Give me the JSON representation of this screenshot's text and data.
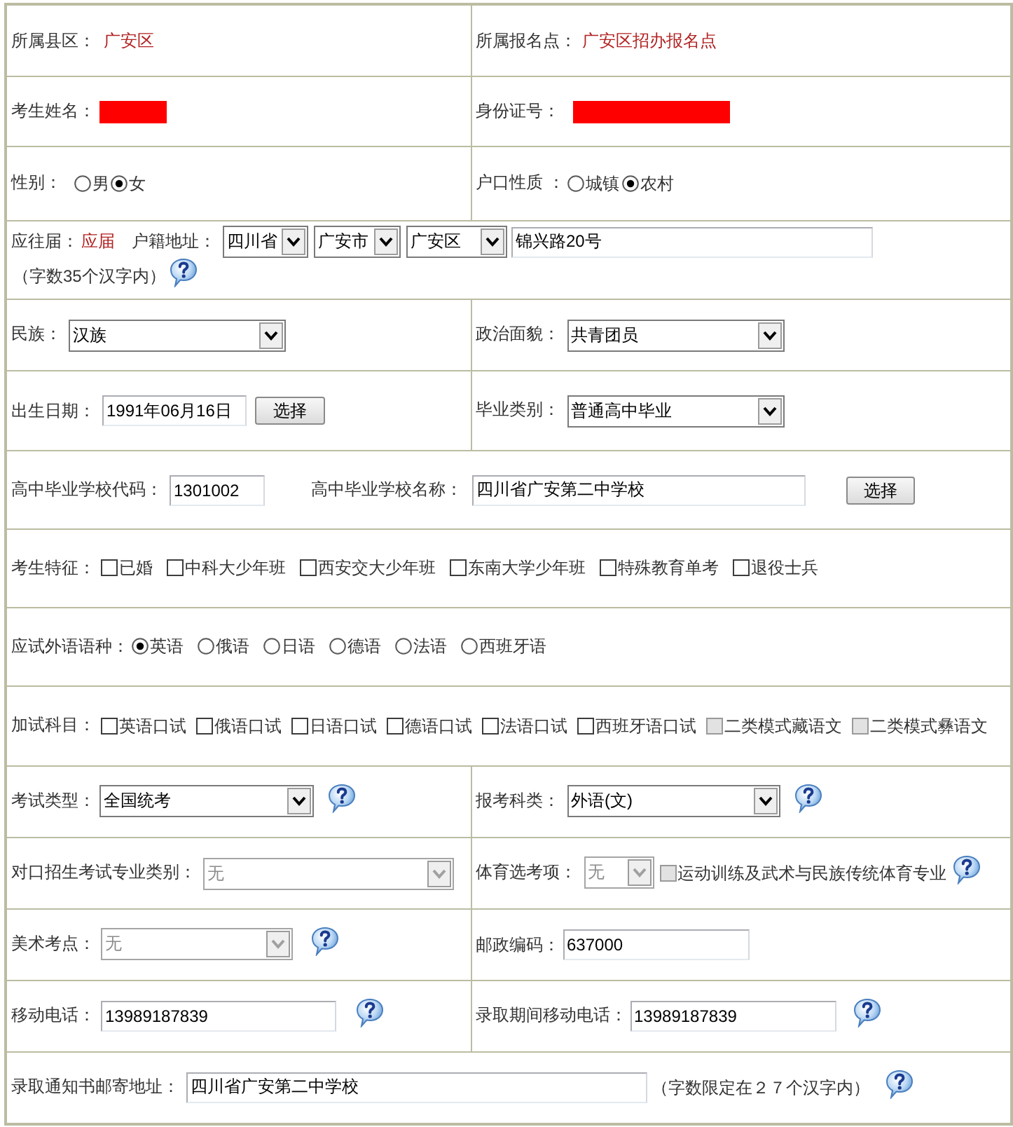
{
  "rows": [
    {
      "cells": [
        {
          "items": [
            {
              "kind": "label",
              "text": "所属县区："
            },
            {
              "kind": "value",
              "text": "广安区"
            }
          ]
        },
        {
          "items": [
            {
              "kind": "label",
              "text": "所属报名点："
            },
            {
              "kind": "value",
              "text": "广安区招办报名点"
            }
          ]
        }
      ]
    },
    {
      "cells": [
        {
          "items": [
            {
              "kind": "label",
              "text": "考生姓名："
            },
            {
              "kind": "redacted"
            }
          ]
        },
        {
          "items": [
            {
              "kind": "label",
              "text": "身份证号："
            },
            {
              "kind": "redacted"
            }
          ]
        }
      ]
    },
    {
      "cells": [
        {
          "items": [
            {
              "kind": "label",
              "text": "性别："
            },
            {
              "kind": "radio",
              "label": "男",
              "selected": false
            },
            {
              "kind": "radio",
              "label": "女",
              "selected": true
            }
          ]
        },
        {
          "items": [
            {
              "kind": "label",
              "text": "户口性质 ："
            },
            {
              "kind": "radio",
              "label": "城镇",
              "selected": false
            },
            {
              "kind": "radio",
              "label": "农村",
              "selected": true
            }
          ]
        }
      ]
    },
    {
      "cells": [
        {
          "items": [
            {
              "kind": "label",
              "text": "应往届："
            },
            {
              "kind": "value",
              "text": "应届"
            },
            {
              "kind": "label",
              "text": "户籍地址："
            },
            {
              "kind": "select",
              "value": "四川省",
              "disabled": false
            },
            {
              "kind": "select",
              "value": "广安市",
              "disabled": false
            },
            {
              "kind": "select",
              "value": "广安区",
              "disabled": false
            },
            {
              "kind": "input",
              "value": "锦兴路20号"
            },
            {
              "kind": "hint",
              "text": "（字数35个汉字内）"
            },
            {
              "kind": "help"
            }
          ]
        }
      ]
    },
    {
      "cells": [
        {
          "items": [
            {
              "kind": "label",
              "text": "民族："
            },
            {
              "kind": "select",
              "value": "汉族",
              "disabled": false
            }
          ]
        },
        {
          "items": [
            {
              "kind": "label",
              "text": "政治面貌："
            },
            {
              "kind": "select",
              "value": "共青团员",
              "disabled": false
            }
          ]
        }
      ]
    },
    {
      "cells": [
        {
          "items": [
            {
              "kind": "label",
              "text": "出生日期："
            },
            {
              "kind": "input",
              "value": "1991年06月16日"
            },
            {
              "kind": "button",
              "text": "选择"
            }
          ]
        },
        {
          "items": [
            {
              "kind": "label",
              "text": "毕业类别："
            },
            {
              "kind": "select",
              "value": "普通高中毕业",
              "disabled": false
            }
          ]
        }
      ]
    },
    {
      "cells": [
        {
          "items": [
            {
              "kind": "label",
              "text": "高中毕业学校代码："
            },
            {
              "kind": "input",
              "value": "1301002"
            },
            {
              "kind": "label",
              "text": "高中毕业学校名称："
            },
            {
              "kind": "input",
              "value": "四川省广安第二中学校"
            },
            {
              "kind": "button",
              "text": "选择"
            }
          ]
        }
      ]
    },
    {
      "cells": [
        {
          "items": [
            {
              "kind": "label",
              "text": "考生特征："
            },
            {
              "kind": "checkbox",
              "label": "已婚",
              "checked": false,
              "disabled": false
            },
            {
              "kind": "checkbox",
              "label": "中科大少年班",
              "checked": false,
              "disabled": false
            },
            {
              "kind": "checkbox",
              "label": "西安交大少年班",
              "checked": false,
              "disabled": false
            },
            {
              "kind": "checkbox",
              "label": "东南大学少年班",
              "checked": false,
              "disabled": false
            },
            {
              "kind": "checkbox",
              "label": "特殊教育单考",
              "checked": false,
              "disabled": false
            },
            {
              "kind": "checkbox",
              "label": "退役士兵",
              "checked": false,
              "disabled": false
            }
          ]
        }
      ]
    },
    {
      "cells": [
        {
          "items": [
            {
              "kind": "label",
              "text": "应试外语语种："
            },
            {
              "kind": "radio",
              "label": "英语",
              "selected": true
            },
            {
              "kind": "radio",
              "label": "俄语",
              "selected": false
            },
            {
              "kind": "radio",
              "label": "日语",
              "selected": false
            },
            {
              "kind": "radio",
              "label": "德语",
              "selected": false
            },
            {
              "kind": "radio",
              "label": "法语",
              "selected": false
            },
            {
              "kind": "radio",
              "label": "西班牙语",
              "selected": false
            }
          ]
        }
      ]
    },
    {
      "cells": [
        {
          "items": [
            {
              "kind": "label",
              "text": "加试科目："
            },
            {
              "kind": "checkbox",
              "label": "英语口试",
              "checked": false,
              "disabled": false
            },
            {
              "kind": "checkbox",
              "label": "俄语口试",
              "checked": false,
              "disabled": false
            },
            {
              "kind": "checkbox",
              "label": "日语口试",
              "checked": false,
              "disabled": false
            },
            {
              "kind": "checkbox",
              "label": "德语口试",
              "checked": false,
              "disabled": false
            },
            {
              "kind": "checkbox",
              "label": "法语口试",
              "checked": false,
              "disabled": false
            },
            {
              "kind": "checkbox",
              "label": "西班牙语口试",
              "checked": false,
              "disabled": false
            },
            {
              "kind": "checkbox",
              "label": "二类模式藏语文",
              "checked": false,
              "disabled": true
            },
            {
              "kind": "checkbox",
              "label": "二类模式彝语文",
              "checked": false,
              "disabled": true
            }
          ]
        }
      ]
    },
    {
      "cells": [
        {
          "items": [
            {
              "kind": "label",
              "text": "考试类型："
            },
            {
              "kind": "select",
              "value": "全国统考",
              "disabled": false
            },
            {
              "kind": "help"
            }
          ]
        },
        {
          "items": [
            {
              "kind": "label",
              "text": "报考科类："
            },
            {
              "kind": "select",
              "value": "外语(文)",
              "disabled": false
            },
            {
              "kind": "help"
            }
          ]
        }
      ]
    },
    {
      "cells": [
        {
          "items": [
            {
              "kind": "label",
              "text": "对口招生考试专业类别："
            },
            {
              "kind": "select",
              "value": "无",
              "disabled": true
            }
          ]
        },
        {
          "items": [
            {
              "kind": "label",
              "text": "体育选考项："
            },
            {
              "kind": "select",
              "value": "无",
              "disabled": true
            },
            {
              "kind": "checkbox",
              "label": "运动训练及武术与民族传统体育专业",
              "checked": false,
              "disabled": true
            },
            {
              "kind": "help"
            }
          ]
        }
      ]
    },
    {
      "cells": [
        {
          "items": [
            {
              "kind": "label",
              "text": "美术考点："
            },
            {
              "kind": "select",
              "value": "无",
              "disabled": true
            },
            {
              "kind": "help"
            }
          ]
        },
        {
          "items": [
            {
              "kind": "label",
              "text": "邮政编码："
            },
            {
              "kind": "input",
              "value": "637000"
            }
          ]
        }
      ]
    },
    {
      "cells": [
        {
          "items": [
            {
              "kind": "label",
              "text": "移动电话："
            },
            {
              "kind": "input",
              "value": "13989187839"
            },
            {
              "kind": "help"
            }
          ]
        },
        {
          "items": [
            {
              "kind": "label",
              "text": "录取期间移动电话："
            },
            {
              "kind": "input",
              "value": "13989187839"
            },
            {
              "kind": "help"
            }
          ]
        }
      ]
    },
    {
      "cells": [
        {
          "items": [
            {
              "kind": "label",
              "text": "录取通知书邮寄地址："
            },
            {
              "kind": "input",
              "value": "四川省广安第二中学校"
            },
            {
              "kind": "hint",
              "text": "（字数限定在２７个汉字内）"
            },
            {
              "kind": "help"
            }
          ]
        }
      ]
    }
  ]
}
